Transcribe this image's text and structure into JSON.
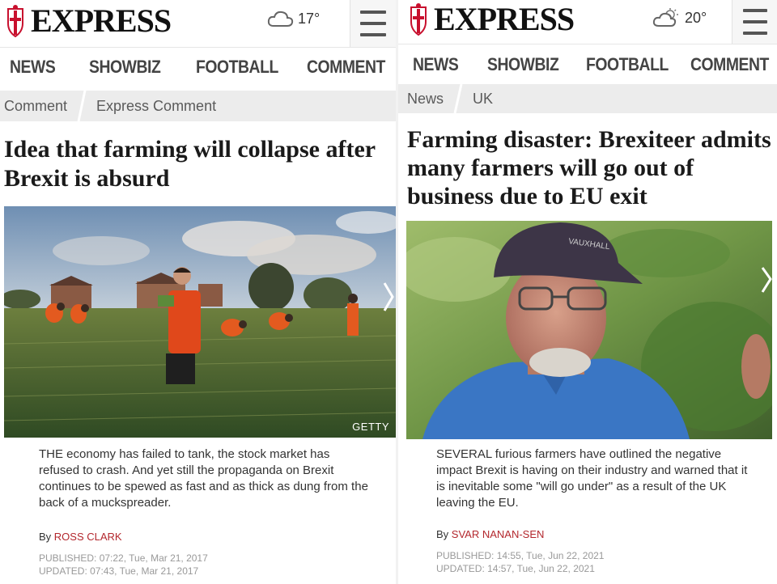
{
  "left": {
    "brand": "EXPRESS",
    "temperature": "17°",
    "weather_icon": "cloud-icon",
    "nav": [
      "NEWS",
      "SHOWBIZ",
      "FOOTBALL",
      "COMMENT"
    ],
    "breadcrumbs": [
      "Comment",
      "Express Comment"
    ],
    "headline": "Idea that farming will collapse after Brexit is absurd",
    "image_credit": "GETTY",
    "summary": "THE economy has failed to tank, the stock market has refused to crash. And yet still the propaganda on Brexit continues to be spewed as fast and as thick as dung from the back of a muckspreader.",
    "byline_prefix": "By ",
    "author": "ROSS CLARK",
    "published": "PUBLISHED: 07:22, Tue, Mar 21, 2017",
    "updated": "UPDATED: 07:43, Tue, Mar 21, 2017"
  },
  "right": {
    "brand": "EXPRESS",
    "temperature": "20°",
    "weather_icon": "sun-cloud-icon",
    "nav": [
      "NEWS",
      "SHOWBIZ",
      "FOOTBALL",
      "COMMENT"
    ],
    "breadcrumbs": [
      "News",
      "UK"
    ],
    "headline": "Farming disaster: Brexiteer admits many farmers will go out of business due to EU exit",
    "cap_text": "VAUXHALL",
    "summary": "SEVERAL furious farmers have outlined the negative impact Brexit is having on their industry and warned that it is inevitable some \"will go under\" as a result of the UK leaving the EU.",
    "byline_prefix": "By ",
    "author": "SVAR NANAN-SEN",
    "published": "PUBLISHED: 14:55, Tue, Jun 22, 2021",
    "updated": "UPDATED: 14:57, Tue, Jun 22, 2021"
  },
  "colors": {
    "brand_red": "#c8102e",
    "author_red": "#b3272d",
    "crumb_bg": "#ececec"
  }
}
